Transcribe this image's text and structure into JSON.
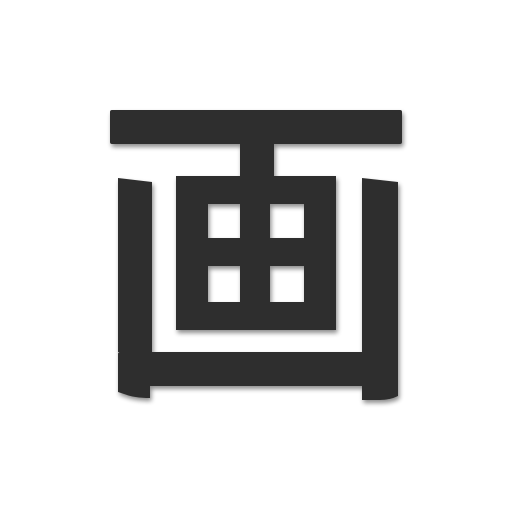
{
  "app_icon": {
    "character": "画",
    "icon_name": "kanji-ga-icon",
    "glyph_color": "#2f2f2f",
    "background_color": "#ffffff",
    "shadow_color": "#9a9a9a"
  }
}
